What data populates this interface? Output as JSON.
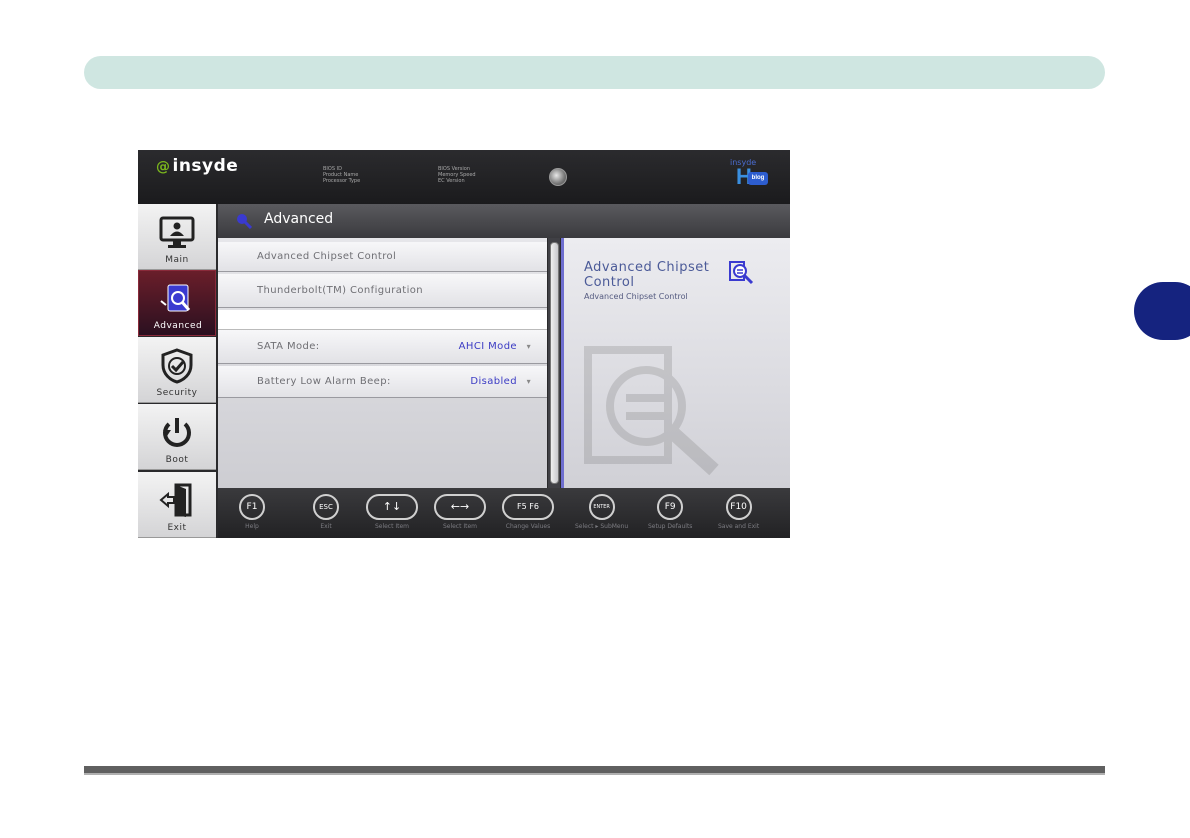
{
  "bios": {
    "logo": "insyde",
    "sysinfo_left": [
      "BIOS ID",
      "Product Name",
      "Processor Type"
    ],
    "sysinfo_right": [
      "BIOS Version",
      "Memory Speed",
      "EC Version"
    ],
    "h2o_logo_text": "insyde",
    "h2o_badge": "blog",
    "sidebar": [
      {
        "label": "Main",
        "icon": "monitor-icon"
      },
      {
        "label": "Advanced",
        "icon": "document-search-icon",
        "active": true
      },
      {
        "label": "Security",
        "icon": "shield-check-icon"
      },
      {
        "label": "Boot",
        "icon": "power-icon"
      },
      {
        "label": "Exit",
        "icon": "exit-door-icon"
      }
    ],
    "page_title": "Advanced",
    "menu": [
      {
        "label": "Advanced Chipset Control",
        "value": ""
      },
      {
        "label": "Thunderbolt(TM) Configuration",
        "value": ""
      },
      {
        "label": "",
        "value": ""
      },
      {
        "label": "SATA Mode:",
        "value": "AHCI Mode"
      },
      {
        "label": "Battery Low Alarm Beep:",
        "value": "Disabled"
      }
    ],
    "help": {
      "title": "Advanced Chipset Control",
      "description": "Advanced Chipset Control"
    },
    "keys": [
      {
        "key": "F1",
        "desc": "Help"
      },
      {
        "key": "ESC",
        "desc": "Exit"
      },
      {
        "key": "↑↓",
        "desc": "Select Item"
      },
      {
        "key": "←→",
        "desc": "Select Item"
      },
      {
        "key": "F5 F6",
        "desc": "Change Values"
      },
      {
        "key": "ENTER",
        "desc": "Select ▸ SubMenu"
      },
      {
        "key": "F9",
        "desc": "Setup Defaults"
      },
      {
        "key": "F10",
        "desc": "Save and Exit"
      }
    ],
    "colors": {
      "accent": "#3b3bc4",
      "active_tab": "#6a1e2a",
      "chapter_tab": "#15237f",
      "header_bar": "#cfe6e1"
    }
  }
}
